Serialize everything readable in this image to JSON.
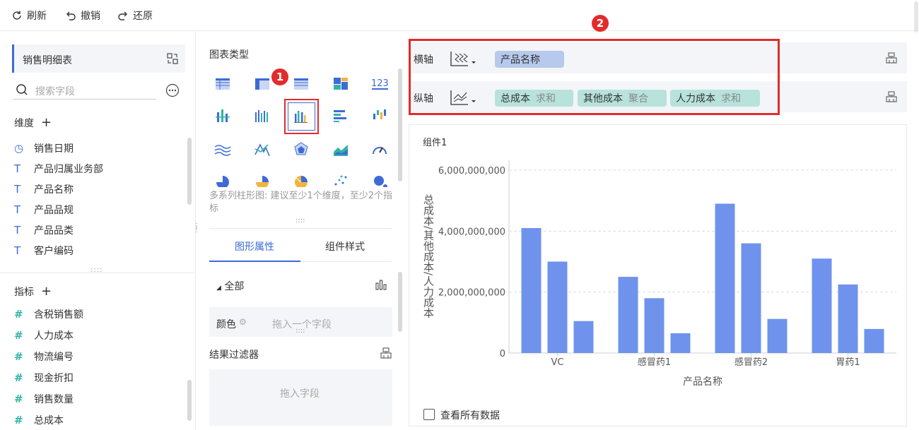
{
  "toolbar": {
    "refresh": "刷新",
    "undo": "撤销",
    "redo": "还原"
  },
  "left_panel": {
    "dataset_name": "销售明细表",
    "search_placeholder": "搜索字段",
    "dimensions_title": "维度",
    "dimensions": [
      {
        "label": "销售日期",
        "icon": "clock-icon"
      },
      {
        "label": "产品归属业务部",
        "icon": "text-icon"
      },
      {
        "label": "产品名称",
        "icon": "text-icon"
      },
      {
        "label": "产品品规",
        "icon": "text-icon"
      },
      {
        "label": "产品品类",
        "icon": "text-icon"
      },
      {
        "label": "客户编码",
        "icon": "text-icon"
      }
    ],
    "metrics_title": "指标",
    "metrics": [
      "含税销售额",
      "人力成本",
      "物流编号",
      "现金折扣",
      "销售数量",
      "总成本"
    ]
  },
  "middle_panel": {
    "chart_type_title": "图表类型",
    "tip": "多系列柱形图: 建议至少1个维度，至少2个指标",
    "tab_graph": "图形属性",
    "tab_style": "组件样式",
    "all_label": "全部",
    "color_label": "颜色",
    "color_placeholder": "拖入一个字段",
    "filter_title": "结果过滤器",
    "filter_placeholder": "拖入字段",
    "number_icon_text": "123"
  },
  "annotations": {
    "badge1": "1",
    "badge2": "2",
    "color": "#e32b2b"
  },
  "axis_panel": {
    "x_label": "横轴",
    "y_label": "纵轴",
    "x_fields": [
      {
        "name": "产品名称",
        "agg": ""
      }
    ],
    "y_fields": [
      {
        "name": "总成本",
        "agg": "求和"
      },
      {
        "name": "其他成本",
        "agg": "聚合"
      },
      {
        "name": "人力成本",
        "agg": "求和"
      }
    ]
  },
  "component": {
    "title": "组件1",
    "view_all_label": "查看所有数据"
  },
  "chart_data": {
    "type": "bar",
    "categories": [
      "VC",
      "感冒药1",
      "感冒药2",
      "胃药1"
    ],
    "series": [
      {
        "name": "总成本",
        "values": [
          4100000000,
          2500000000,
          4900000000,
          3100000000
        ]
      },
      {
        "name": "其他成本",
        "values": [
          3000000000,
          1800000000,
          3600000000,
          2250000000
        ]
      },
      {
        "name": "人力成本",
        "values": [
          1050000000,
          650000000,
          1120000000,
          790000000
        ]
      }
    ],
    "xlabel": "产品名称",
    "ylabel": "总成本/其他成本/人力成本",
    "yticks": [
      "0",
      "2,000,000,000",
      "4,000,000,000",
      "6,000,000,000"
    ],
    "ylim": [
      0,
      6000000000
    ],
    "color": "#6f93ec",
    "grid": true
  }
}
